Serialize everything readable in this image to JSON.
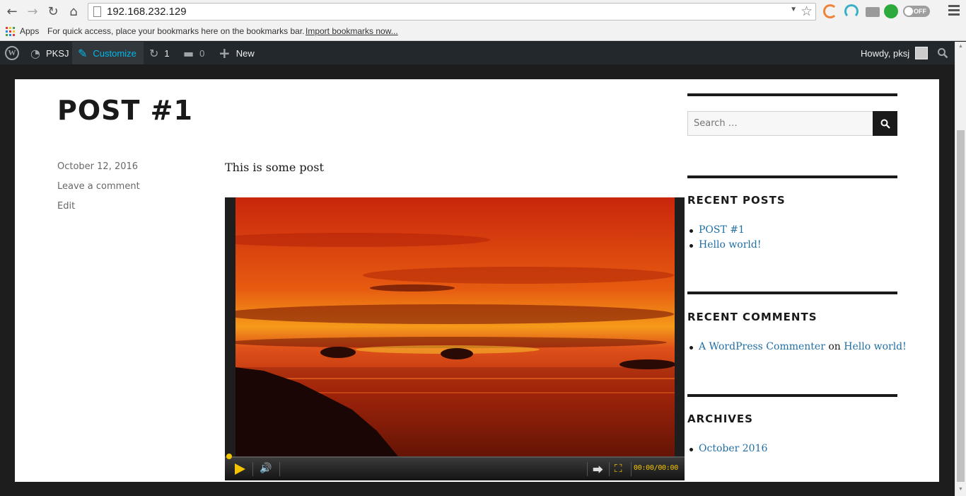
{
  "browser": {
    "url": "192.168.232.129",
    "extension_toggle_label": "OFF"
  },
  "bookmarks": {
    "apps_label": "Apps",
    "message": "For quick access, place your bookmarks here on the bookmarks bar.",
    "import_link": "Import bookmarks now..."
  },
  "adminbar": {
    "site_name": "PKSJ",
    "customize": "Customize",
    "updates_count": "1",
    "comments_count": "0",
    "new_label": "New",
    "greeting": "Howdy, pksj"
  },
  "post": {
    "title": "POST #1",
    "date": "October 12, 2016",
    "leave_comment": "Leave a comment",
    "edit": "Edit",
    "body": "This is some post"
  },
  "video": {
    "time": "00:00/00:00",
    "progress": 0
  },
  "sidebar": {
    "search_placeholder": "Search …",
    "recent_posts_heading": "RECENT POSTS",
    "recent_posts": [
      "POST #1",
      "Hello world!"
    ],
    "recent_comments_heading": "RECENT COMMENTS",
    "recent_comment": {
      "author": "A WordPress Commenter",
      "connector": "on",
      "post": "Hello world!"
    },
    "archives_heading": "ARCHIVES",
    "archives": [
      "October 2016"
    ]
  },
  "colors": {
    "admin_bar": "#23282d",
    "link": "#1f6ea4",
    "accent": "#00b9eb",
    "player_accent": "#f5c400"
  },
  "icons": [
    "back-arrow-icon",
    "forward-arrow-icon",
    "reload-icon",
    "home-icon",
    "bookmark-star-icon",
    "wordpress-logo-icon",
    "dashboard-icon",
    "customize-brush-icon",
    "updates-icon",
    "comments-icon",
    "plus-icon",
    "search-icon",
    "play-icon",
    "volume-icon",
    "share-icon",
    "fullscreen-icon"
  ]
}
